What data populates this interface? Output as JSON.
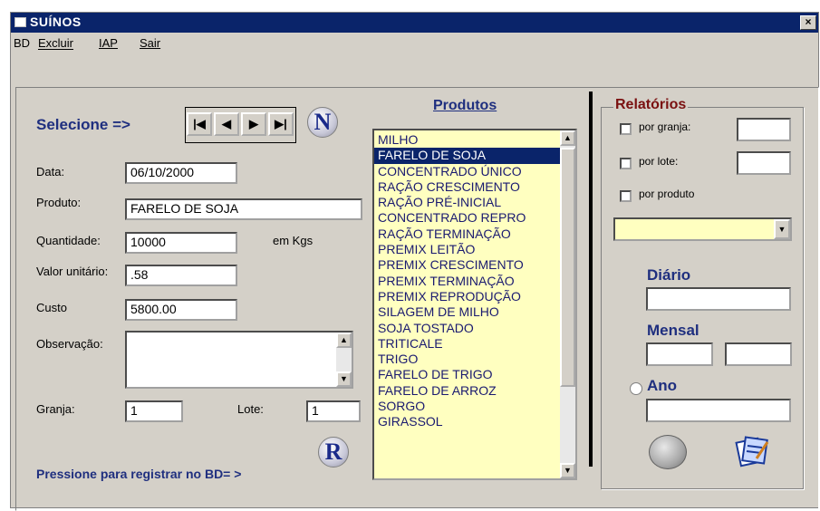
{
  "window": {
    "title": "SUÍNOS",
    "close_label": "×"
  },
  "menu": [
    {
      "label": "BD"
    },
    {
      "label": "Excluir"
    },
    {
      "label": "IAP"
    },
    {
      "label": "Sair"
    }
  ],
  "nav": {
    "selecione_label": "Selecione =>",
    "first": "|◀",
    "prev": "◀",
    "next": "▶",
    "last": "▶|",
    "new_button": "N"
  },
  "form": {
    "data_label": "Data:",
    "data_value": "06/10/2000",
    "produto_label": "Produto:",
    "produto_value": "FARELO DE SOJA",
    "quantidade_label": "Quantidade:",
    "quantidade_value": "10000",
    "unit_label": "em Kgs",
    "valor_label": "Valor unitário:",
    "valor_value": ".58",
    "custo_label": "Custo",
    "custo_value": "5800.00",
    "observacao_label": "Observação:",
    "observacao_value": "",
    "granja_label": "Granja:",
    "granja_value": "1",
    "lote_label": "Lote:",
    "lote_value": "1"
  },
  "register": {
    "label": "Pressione para registrar no BD= >",
    "button": "R"
  },
  "produtos": {
    "title": "Produtos",
    "items": [
      "MILHO",
      "FARELO DE SOJA",
      "CONCENTRADO ÚNICO",
      "RAÇÃO CRESCIMENTO",
      "RAÇÃO PRÉ-INICIAL",
      "CONCENTRADO REPRO",
      "RAÇÃO TERMINAÇÃO",
      "PREMIX LEITÃO",
      "PREMIX CRESCIMENTO",
      "PREMIX TERMINAÇÃO",
      "PREMIX REPRODUÇÃO",
      "SILAGEM DE MILHO",
      "SOJA TOSTADO",
      "TRITICALE",
      "TRIGO",
      "FARELO DE TRIGO",
      "FARELO DE ARROZ",
      "SORGO",
      "GIRASSOL"
    ],
    "selected": "FARELO DE SOJA"
  },
  "relatorios": {
    "title": "Relatórios",
    "por_granja": "por granja:",
    "por_lote": "por lote:",
    "por_produto": "por produto",
    "diario": "Diário",
    "mensal": "Mensal",
    "ano": "Ano"
  }
}
